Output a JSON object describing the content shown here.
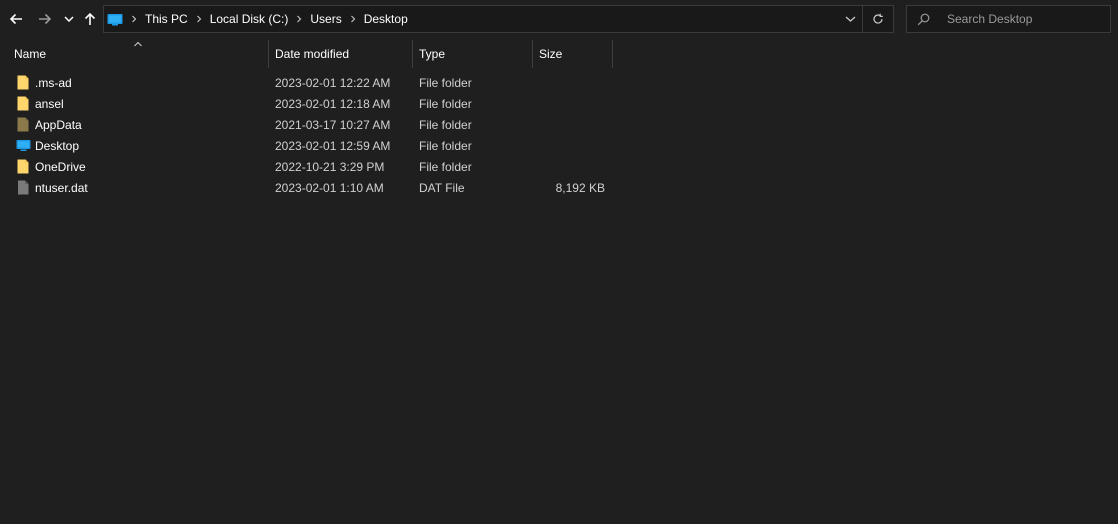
{
  "navigation": {
    "back_icon": "arrow-left",
    "forward_icon": "arrow-right",
    "recent_icon": "chevron-down",
    "up_icon": "arrow-up"
  },
  "address_bar": {
    "location_icon": "desktop-folder-icon",
    "breadcrumbs": [
      "This PC",
      "Local Disk (C:)",
      "Users",
      "Desktop"
    ],
    "dropdown_icon": "chevron-down",
    "refresh_icon": "refresh"
  },
  "search": {
    "placeholder": "Search Desktop",
    "value": ""
  },
  "columns": {
    "name": "Name",
    "date_modified": "Date modified",
    "type": "Type",
    "size": "Size",
    "sorted_by": "name"
  },
  "files": [
    {
      "name": ".ms-ad",
      "date": "2023-02-01 12:22 AM",
      "type": "File folder",
      "size": "",
      "icon": "folder"
    },
    {
      "name": "ansel",
      "date": "2023-02-01 12:18 AM",
      "type": "File folder",
      "size": "",
      "icon": "folder"
    },
    {
      "name": "AppData",
      "date": "2021-03-17 10:27 AM",
      "type": "File folder",
      "size": "",
      "icon": "folder-hidden"
    },
    {
      "name": "Desktop",
      "date": "2023-02-01 12:59 AM",
      "type": "File folder",
      "size": "",
      "icon": "desktop-folder"
    },
    {
      "name": "OneDrive",
      "date": "2022-10-21 3:29 PM",
      "type": "File folder",
      "size": "",
      "icon": "folder"
    },
    {
      "name": "ntuser.dat",
      "date": "2023-02-01 1:10 AM",
      "type": "DAT File",
      "size": "8,192 KB",
      "icon": "file-hidden"
    }
  ],
  "colors": {
    "background": "#1f1f1f",
    "folder": "#ffd66b",
    "folder_hidden": "#8a7a4a",
    "desktop_blue": "#1e9ae6",
    "file_hidden": "#7a7a7a"
  }
}
